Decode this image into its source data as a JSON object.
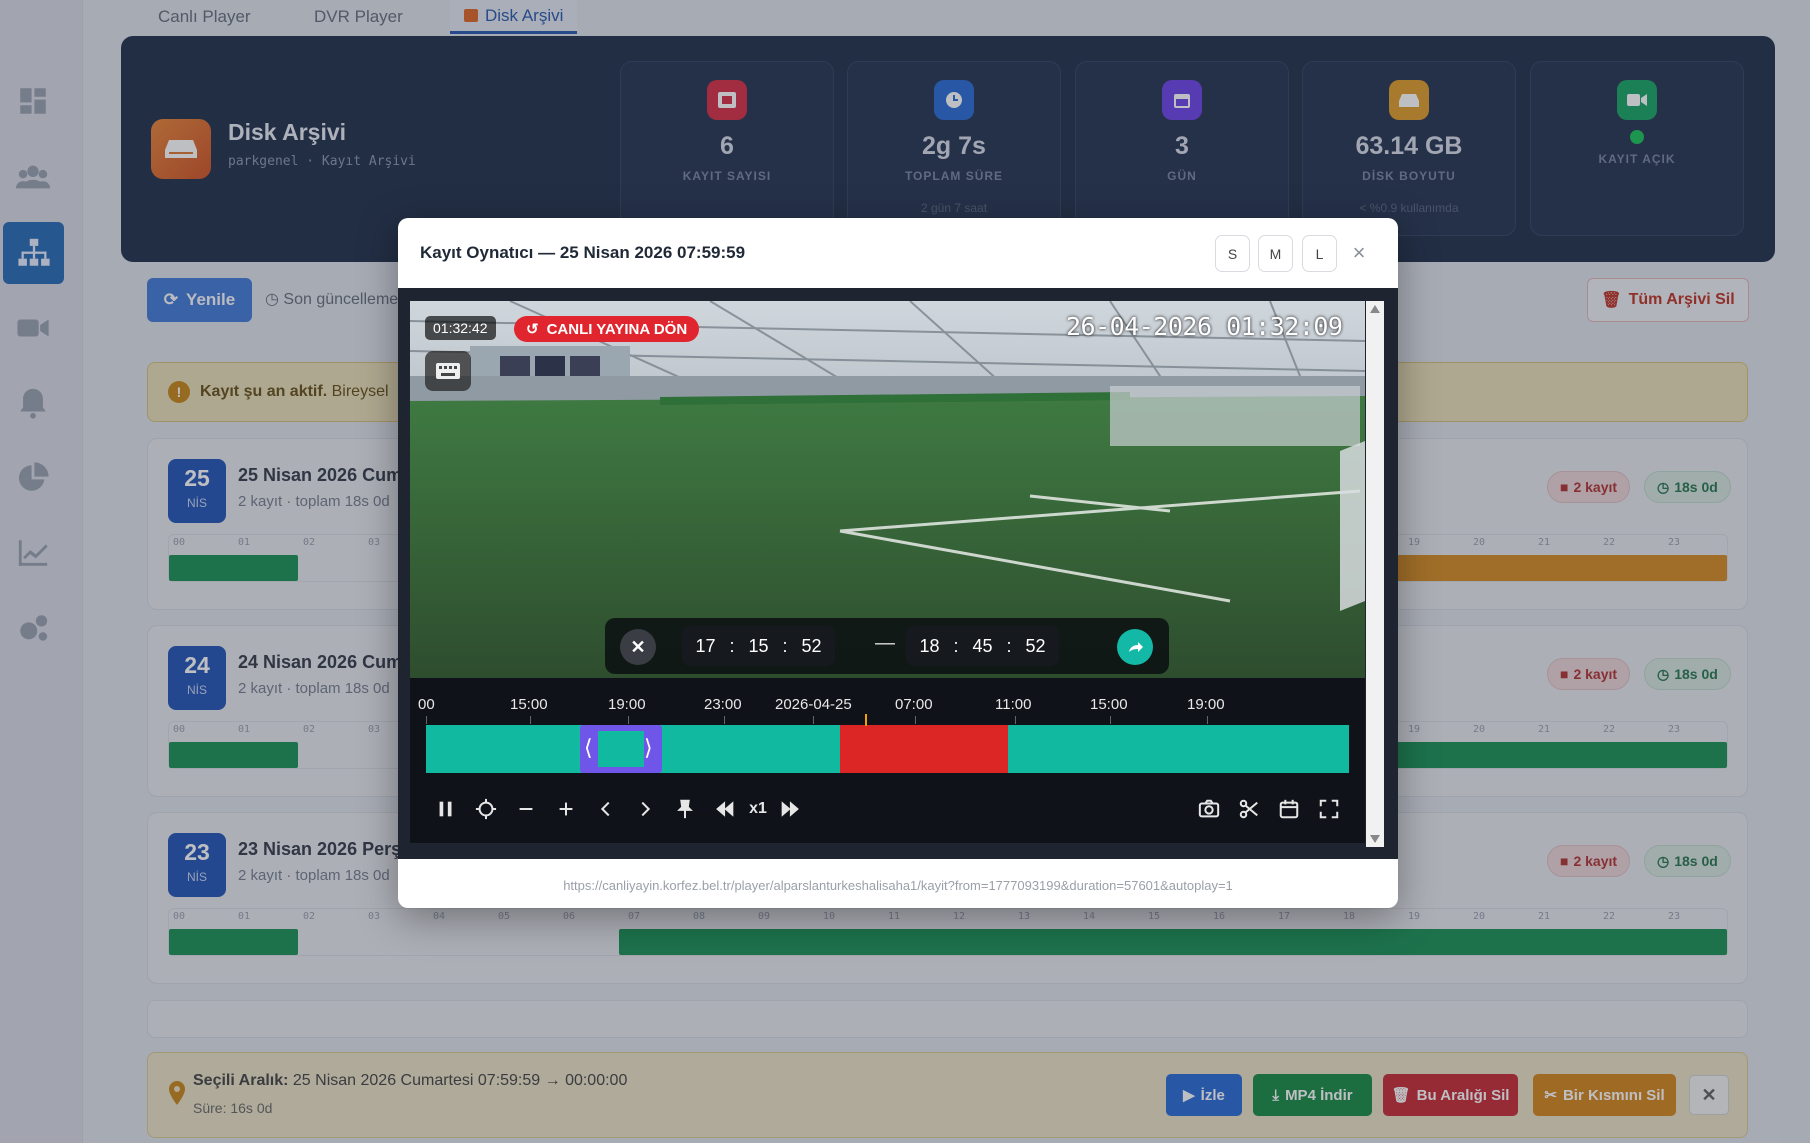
{
  "tabs": [
    {
      "label": "Canlı Player"
    },
    {
      "label": "DVR Player"
    },
    {
      "label": "Disk Arşivi"
    }
  ],
  "header": {
    "title": "Disk Arşivi",
    "subtitle": "parkgenel · Kayıt Arşivi"
  },
  "stats": [
    {
      "value": "6",
      "label": "KAYIT SAYISI",
      "sub": "",
      "color": "#dc3545"
    },
    {
      "value": "2g 7s",
      "label": "TOPLAM SÜRE",
      "sub": "2 gün 7 saat",
      "color": "#2f6fd6"
    },
    {
      "value": "3",
      "label": "GÜN",
      "sub": "",
      "color": "#7048e8"
    },
    {
      "value": "63.14 GB",
      "label": "DİSK BOYUTU",
      "sub": "< %0.9 kullanımda",
      "color": "#e0a030"
    },
    {
      "value": "",
      "label": "KAYIT AÇIK",
      "sub": "",
      "color": "#1fa868"
    }
  ],
  "toolbar": {
    "refresh_label": "Yenile",
    "last_update": "Son güncelleme:",
    "delete_all_label": "Tüm Arşivi Sil"
  },
  "active_notice": {
    "bold": "Kayıt şu an aktif.",
    "text": "Bireysel"
  },
  "days": [
    {
      "num": "25",
      "month": "NİS",
      "title": "25 Nisan 2026 Cum",
      "sub": "2 kayıt · toplam 18s 0d",
      "rec_chip": "2 kayıt",
      "dur_chip": "18s 0d"
    },
    {
      "num": "24",
      "month": "NİS",
      "title": "24 Nisan 2026 Cum",
      "sub": "2 kayıt · toplam 18s 0d",
      "rec_chip": "2 kayıt",
      "dur_chip": "18s 0d"
    },
    {
      "num": "23",
      "month": "NİS",
      "title": "23 Nisan 2026 Perş",
      "sub": "2 kayıt · toplam 18s 0d",
      "rec_chip": "2 kayıt",
      "dur_chip": "18s 0d"
    }
  ],
  "hour_labels": [
    "00",
    "01",
    "02",
    "03",
    "04",
    "05",
    "06",
    "07",
    "08",
    "09",
    "10",
    "11",
    "12",
    "13",
    "14",
    "15",
    "16",
    "17",
    "18",
    "19",
    "20",
    "21",
    "22",
    "23"
  ],
  "selection": {
    "label": "Seçili Aralık:",
    "value": "25 Nisan 2026 Cumartesi 07:59:59 → 00:00:00",
    "duration": "Süre: 16s 0d",
    "watch": "İzle",
    "download": "MP4 İndir",
    "delete_range": "Bu Aralığı Sil",
    "delete_part": "Bir Kısmını Sil"
  },
  "modal": {
    "title": "Kayıt Oynatıcı — 25 Nisan 2026 07:59:59",
    "sizes": [
      "S",
      "M",
      "L"
    ],
    "osd_time": "01:32:42",
    "live_label": "CANLI YAYINA DÖN",
    "cam_timestamp": "26-04-2026 01:32:09",
    "range_start": {
      "h": "17",
      "m": "15",
      "s": "52"
    },
    "range_end": {
      "h": "18",
      "m": "45",
      "s": "52"
    },
    "timeline_labels": [
      "00",
      "15:00",
      "19:00",
      "23:00",
      "2026-04-25",
      "07:00",
      "11:00",
      "15:00",
      "19:00"
    ],
    "speed": "x1",
    "url": "https://canliyayin.korfez.bel.tr/player/alparslanturkeshalisaha1/kayit?from=1777093199&duration=57601&autoplay=1"
  }
}
